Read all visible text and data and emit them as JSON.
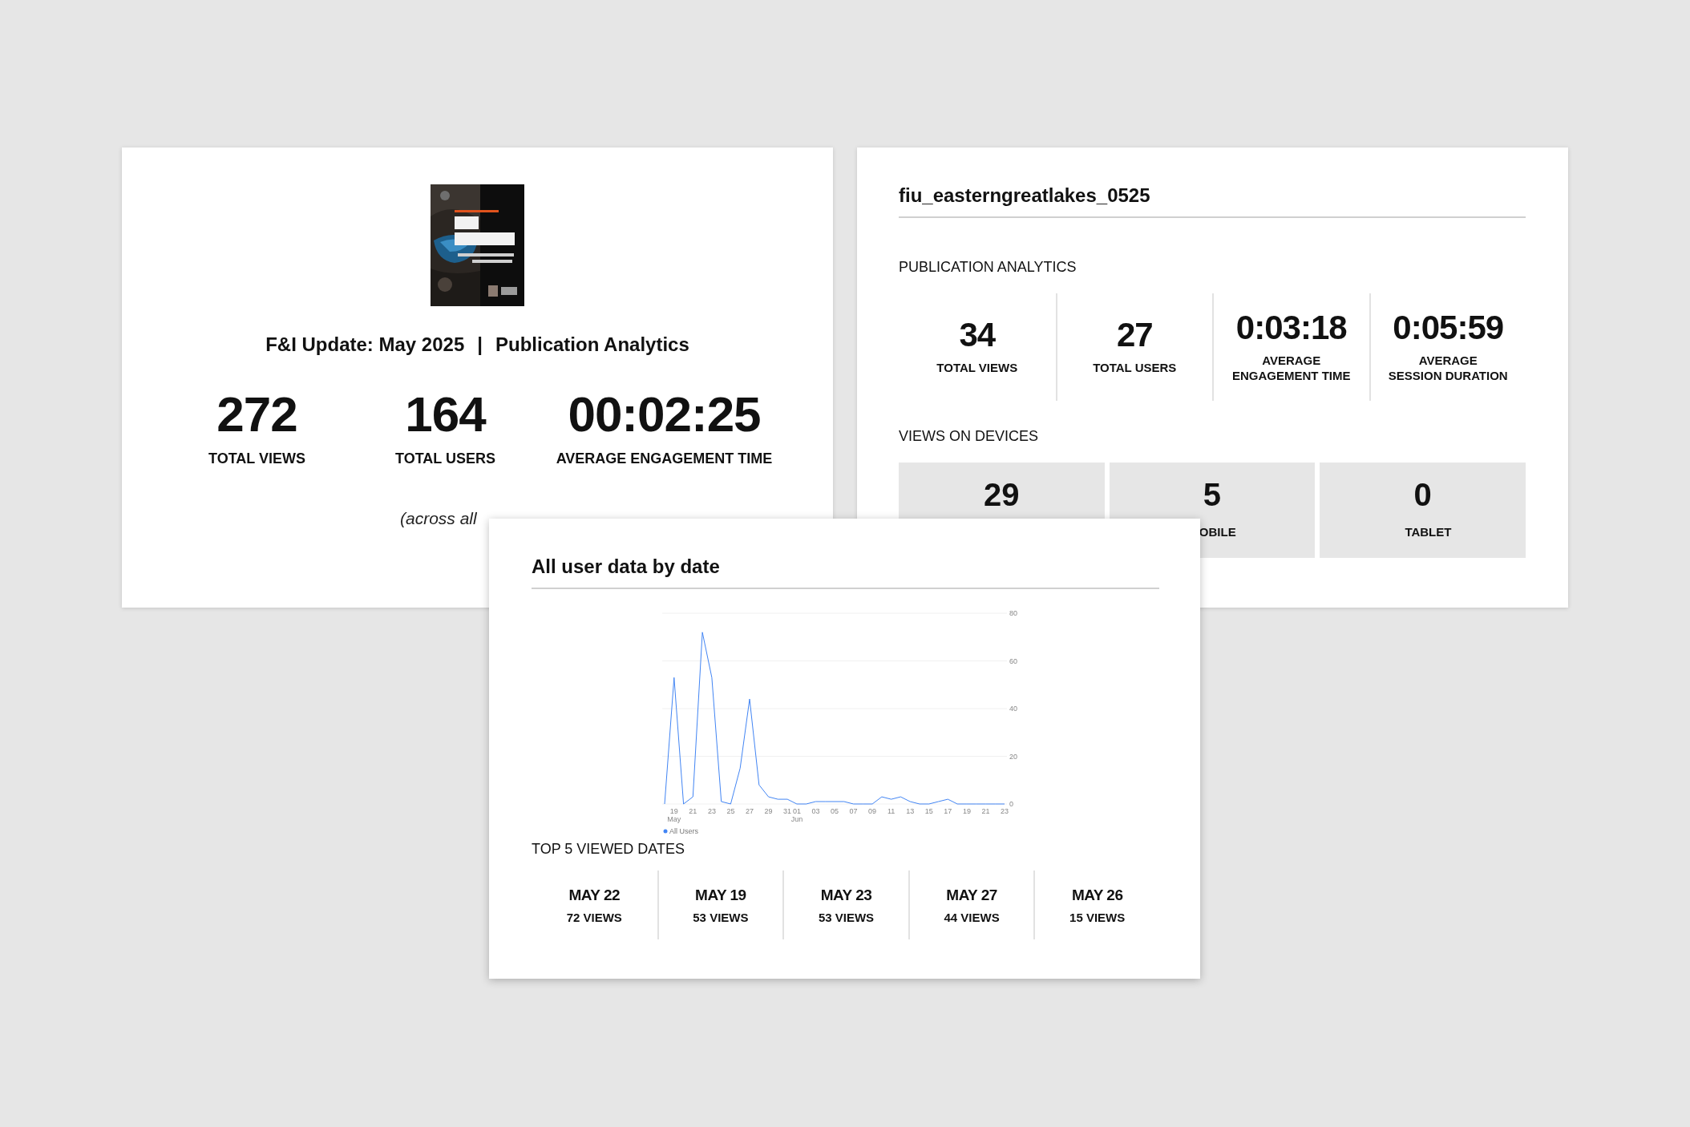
{
  "publication_card": {
    "title": "F&I Update: May 2025",
    "separator": "|",
    "subtitle": "Publication Analytics",
    "stats": [
      {
        "value": "272",
        "label": "TOTAL VIEWS"
      },
      {
        "value": "164",
        "label": "TOTAL USERS"
      },
      {
        "value": "00:02:25",
        "label": "AVERAGE ENGAGEMENT TIME"
      }
    ],
    "note": "(across all"
  },
  "file_card": {
    "title": "fiu_easterngreatlakes_0525",
    "section": "PUBLICATION ANALYTICS",
    "stats": [
      {
        "value": "34",
        "label": "TOTAL VIEWS"
      },
      {
        "value": "27",
        "label": "TOTAL USERS"
      },
      {
        "value": "0:03:18",
        "label": "AVERAGE",
        "label_2": "ENGAGEMENT TIME"
      },
      {
        "value": "0:05:59",
        "label": "AVERAGE",
        "label_2": "SESSION DURATION"
      }
    ],
    "devices_heading": "VIEWS ON DEVICES",
    "devices": [
      {
        "value": "29"
      },
      {
        "value": "5",
        "label": "OBILE"
      },
      {
        "value": "0",
        "label": "TABLET"
      }
    ]
  },
  "date_card": {
    "title": "All user data by date",
    "chart_data": {
      "type": "line",
      "ylim": [
        0,
        80
      ],
      "yticks": [
        0,
        20,
        40,
        60,
        80
      ],
      "grid": true,
      "categories": [
        null,
        "19 May",
        null,
        "21",
        null,
        "23",
        null,
        "25",
        null,
        "27",
        null,
        "29",
        null,
        "31",
        "01 Jun",
        null,
        "03",
        null,
        "05",
        null,
        "07",
        null,
        "09",
        null,
        "11",
        null,
        "13",
        null,
        "15",
        null,
        "17",
        null,
        "19",
        null,
        "21",
        null,
        "23"
      ],
      "series": [
        {
          "name": "All Users",
          "color": "#4285f4",
          "values": [
            0,
            53,
            0,
            3,
            72,
            53,
            1,
            0,
            15,
            44,
            8,
            3,
            2,
            2,
            0,
            0,
            1,
            1,
            1,
            1,
            0,
            0,
            0,
            3,
            2,
            3,
            1,
            0,
            0,
            1,
            2,
            0,
            0,
            0,
            0,
            0,
            0
          ]
        }
      ]
    },
    "top_heading": "TOP 5 VIEWED DATES",
    "top_dates": [
      {
        "date": "MAY 22",
        "views": "72 VIEWS"
      },
      {
        "date": "MAY 19",
        "views": "53 VIEWS"
      },
      {
        "date": "MAY 23",
        "views": "53 VIEWS"
      },
      {
        "date": "MAY 27",
        "views": "44 VIEWS"
      },
      {
        "date": "MAY 26",
        "views": "15 VIEWS"
      }
    ]
  }
}
